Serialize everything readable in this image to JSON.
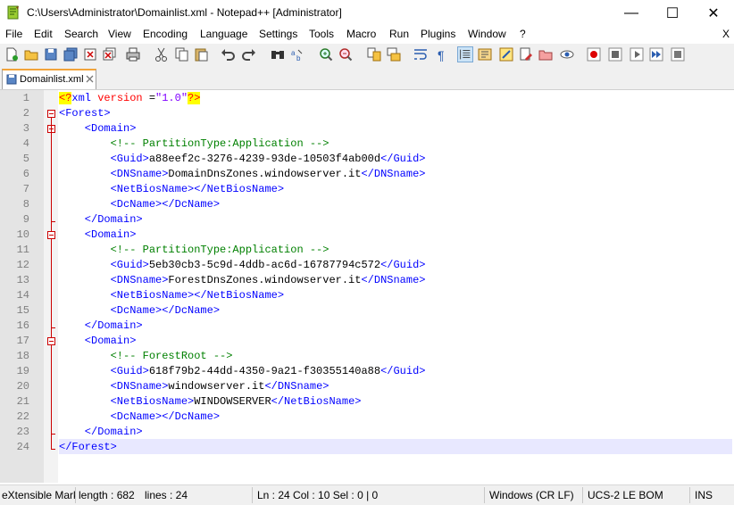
{
  "window": {
    "title": "C:\\Users\\Administrator\\Domainlist.xml - Notepad++ [Administrator]",
    "minimize_glyph": "—",
    "maximize_glyph": "☐",
    "close_glyph": "✕"
  },
  "menu": {
    "items": [
      "File",
      "Edit",
      "Search",
      "View",
      "Encoding",
      "Language",
      "Settings",
      "Tools",
      "Macro",
      "Run",
      "Plugins",
      "Window",
      "?"
    ],
    "close_label": "X"
  },
  "toolbar": {
    "icons": [
      "new-file-icon",
      "open-file-icon",
      "save-icon",
      "save-all-icon",
      "close-icon",
      "close-all-icon",
      "print-icon",
      "cut-icon",
      "copy-icon",
      "paste-icon",
      "undo-icon",
      "redo-icon",
      "find-icon",
      "replace-icon",
      "zoom-in-icon",
      "zoom-out-icon",
      "sync-vertical-icon",
      "sync-horizontal-icon",
      "word-wrap-icon",
      "show-all-chars-icon",
      "indent-guide-icon",
      "doc-map-icon",
      "function-list-icon",
      "folder-as-workspace-icon",
      "monitoring-icon",
      "record-macro-icon",
      "stop-record-icon",
      "play-macro-icon",
      "run-macro-multiple-icon",
      "save-macro-icon"
    ]
  },
  "tab": {
    "label": "Domainlist.xml"
  },
  "editor": {
    "line_numbers": [
      "1",
      "2",
      "3",
      "4",
      "5",
      "6",
      "7",
      "8",
      "9",
      "10",
      "11",
      "12",
      "13",
      "14",
      "15",
      "16",
      "17",
      "18",
      "19",
      "20",
      "21",
      "22",
      "23",
      "24"
    ],
    "lines": [
      [
        {
          "t": "<?",
          "c": "pi"
        },
        {
          "t": "xml ",
          "c": "tag"
        },
        {
          "t": "version ",
          "c": "attr"
        },
        {
          "t": "=",
          "c": "text"
        },
        {
          "t": "\"1.0\"",
          "c": "val"
        },
        {
          "t": "?>",
          "c": "pi"
        }
      ],
      [
        {
          "t": "<Forest>",
          "c": "tag"
        }
      ],
      [
        {
          "t": "    <Domain>",
          "c": "tag"
        }
      ],
      [
        {
          "t": "        <!-- PartitionType:Application -->",
          "c": "comment"
        }
      ],
      [
        {
          "t": "        <Guid>",
          "c": "tag"
        },
        {
          "t": "a88eef2c-3276-4239-93de-10503f4ab00d",
          "c": "text"
        },
        {
          "t": "</Guid>",
          "c": "tag"
        }
      ],
      [
        {
          "t": "        <DNSname>",
          "c": "tag"
        },
        {
          "t": "DomainDnsZones.windowserver.it",
          "c": "text"
        },
        {
          "t": "</DNSname>",
          "c": "tag"
        }
      ],
      [
        {
          "t": "        <NetBiosName></NetBiosName>",
          "c": "tag"
        }
      ],
      [
        {
          "t": "        <DcName></DcName>",
          "c": "tag"
        }
      ],
      [
        {
          "t": "    </Domain>",
          "c": "tag"
        }
      ],
      [
        {
          "t": "    <Domain>",
          "c": "tag"
        }
      ],
      [
        {
          "t": "        <!-- PartitionType:Application -->",
          "c": "comment"
        }
      ],
      [
        {
          "t": "        <Guid>",
          "c": "tag"
        },
        {
          "t": "5eb30cb3-5c9d-4ddb-ac6d-16787794c572",
          "c": "text"
        },
        {
          "t": "</Guid>",
          "c": "tag"
        }
      ],
      [
        {
          "t": "        <DNSname>",
          "c": "tag"
        },
        {
          "t": "ForestDnsZones.windowserver.it",
          "c": "text"
        },
        {
          "t": "</DNSname>",
          "c": "tag"
        }
      ],
      [
        {
          "t": "        <NetBiosName></NetBiosName>",
          "c": "tag"
        }
      ],
      [
        {
          "t": "        <DcName></DcName>",
          "c": "tag"
        }
      ],
      [
        {
          "t": "    </Domain>",
          "c": "tag"
        }
      ],
      [
        {
          "t": "    <Domain>",
          "c": "tag"
        }
      ],
      [
        {
          "t": "        <!-- ForestRoot -->",
          "c": "comment"
        }
      ],
      [
        {
          "t": "        <Guid>",
          "c": "tag"
        },
        {
          "t": "618f79b2-44dd-4350-9a21-f30355140a88",
          "c": "text"
        },
        {
          "t": "</Guid>",
          "c": "tag"
        }
      ],
      [
        {
          "t": "        <DNSname>",
          "c": "tag"
        },
        {
          "t": "windowserver.it",
          "c": "text"
        },
        {
          "t": "</DNSname>",
          "c": "tag"
        }
      ],
      [
        {
          "t": "        <NetBiosName>",
          "c": "tag"
        },
        {
          "t": "WINDOWSERVER",
          "c": "text"
        },
        {
          "t": "</NetBiosName>",
          "c": "tag"
        }
      ],
      [
        {
          "t": "        <DcName></DcName>",
          "c": "tag"
        }
      ],
      [
        {
          "t": "    </Domain>",
          "c": "tag"
        }
      ],
      [
        {
          "t": "</Forest>",
          "c": "tag"
        }
      ]
    ]
  },
  "status": {
    "filetype": "eXtensible Mark",
    "length": "length : 682",
    "lines": "lines : 24",
    "position": "Ln : 24    Col : 10    Sel : 0 | 0",
    "eol": "Windows (CR LF)",
    "encoding": "UCS-2 LE BOM",
    "mode": "INS"
  },
  "colors": {
    "tag": "#0000ff",
    "comment": "#008000",
    "attr": "#ff0000",
    "value": "#8000ff",
    "pi_highlight": "#ffff00",
    "fold": "#cc0000",
    "caret_line": "#e8e8ff"
  }
}
